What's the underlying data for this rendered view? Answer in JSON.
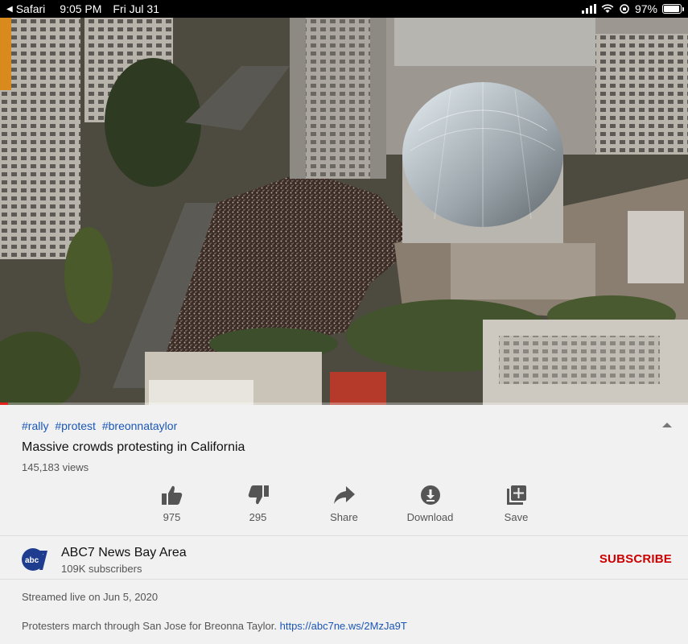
{
  "status_bar": {
    "back_app": "Safari",
    "time": "9:05 PM",
    "date": "Fri Jul 31",
    "battery_percent": "97%",
    "battery_level": 0.97
  },
  "video": {
    "progress_fraction": 0.012
  },
  "hashtags": [
    "#rally",
    "#protest",
    "#breonnataylor"
  ],
  "title": "Massive crowds protesting in California",
  "views": "145,183 views",
  "actions": [
    {
      "label": "975",
      "icon": "thumbs-up-icon"
    },
    {
      "label": "295",
      "icon": "thumbs-down-icon"
    },
    {
      "label": "Share",
      "icon": "share-icon"
    },
    {
      "label": "Download",
      "icon": "download-icon"
    },
    {
      "label": "Save",
      "icon": "save-playlist-icon"
    }
  ],
  "channel": {
    "name": "ABC7 News Bay Area",
    "subscribers": "109K subscribers",
    "subscribe_label": "SUBSCRIBE",
    "logo_text": "abc"
  },
  "streamed": "Streamed live on Jun 5, 2020",
  "description": {
    "text": "Protesters march through San Jose for Breonna Taylor. ",
    "link": "https://abc7ne.ws/2MzJa9T"
  },
  "colors": {
    "link": "#1a56b8",
    "subscribe": "#cc0000",
    "progress": "#e62117",
    "logo": "#1f3d8f"
  }
}
